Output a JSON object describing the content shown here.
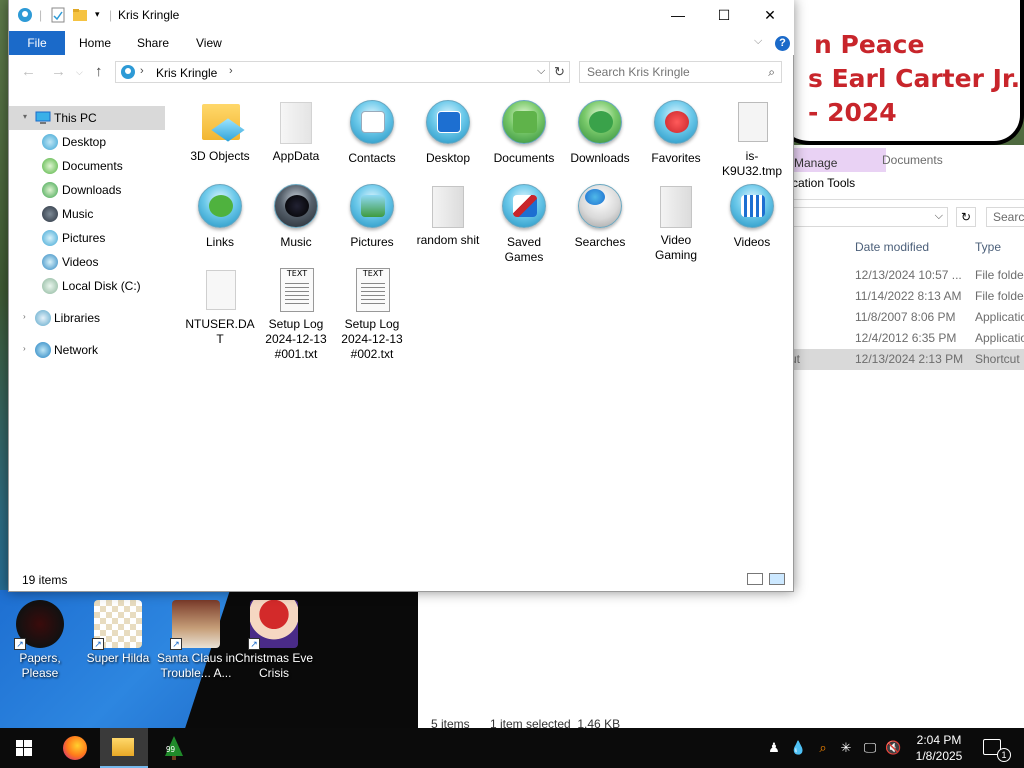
{
  "background_window": {
    "banner_lines": [
      "n Peace",
      "s Earl Carter Jr.",
      "- 2024"
    ],
    "ribbon": {
      "manage_label": "Manage",
      "app_tools_label": "cation Tools",
      "documents_tab": "Documents"
    },
    "search_placeholder": "Searc",
    "columns": {
      "date_modified": "Date modified",
      "type": "Type"
    },
    "rows": [
      {
        "name": "",
        "date": "12/13/2024 10:57 ...",
        "type": "File folde"
      },
      {
        "name": "",
        "date": "11/14/2022 8:13 AM",
        "type": "File folde"
      },
      {
        "name": "",
        "date": "11/8/2007 8:06 PM",
        "type": "Applicatio"
      },
      {
        "name": "",
        "date": "12/4/2012 6:35 PM",
        "type": "Applicatio"
      },
      {
        "name": "ut",
        "date": "12/13/2024 2:13 PM",
        "type": "Shortcut"
      }
    ],
    "status": {
      "items": "5 items",
      "selected": "1 item selected  1.46 KB"
    }
  },
  "desktop_icons": [
    {
      "label": "Papers, Please"
    },
    {
      "label": "Super Hilda"
    },
    {
      "label": "Santa Claus in Trouble... A..."
    },
    {
      "label": "Christmas Eve Crisis"
    }
  ],
  "window": {
    "title": "Kris Kringle",
    "ribbon_tabs": {
      "file": "File",
      "home": "Home",
      "share": "Share",
      "view": "View"
    },
    "help_glyph": "?",
    "address": {
      "crumb": "Kris Kringle"
    },
    "search_placeholder": "Search Kris Kringle",
    "nav_pane": [
      {
        "label": "This PC",
        "icon": "computer-icon"
      },
      {
        "label": "Desktop",
        "icon": "desktop-icon"
      },
      {
        "label": "Documents",
        "icon": "documents-icon"
      },
      {
        "label": "Downloads",
        "icon": "downloads-icon"
      },
      {
        "label": "Music",
        "icon": "music-icon"
      },
      {
        "label": "Pictures",
        "icon": "pictures-icon"
      },
      {
        "label": "Videos",
        "icon": "videos-icon"
      },
      {
        "label": "Local Disk (C:)",
        "icon": "drive-icon"
      },
      {
        "label": "Libraries",
        "icon": "libraries-icon"
      },
      {
        "label": "Network",
        "icon": "network-icon"
      }
    ],
    "items": [
      {
        "label": "3D Objects",
        "icon": "3d-objects-folder-icon"
      },
      {
        "label": "AppData",
        "icon": "hidden-folder-icon"
      },
      {
        "label": "Contacts",
        "icon": "contacts-icon"
      },
      {
        "label": "Desktop",
        "icon": "desktop-folder-icon"
      },
      {
        "label": "Documents",
        "icon": "documents-folder-icon"
      },
      {
        "label": "Downloads",
        "icon": "downloads-folder-icon"
      },
      {
        "label": "Favorites",
        "icon": "favorites-icon"
      },
      {
        "label": "is-K9U32.tmp",
        "icon": "tmp-file-icon"
      },
      {
        "label": "Links",
        "icon": "links-icon"
      },
      {
        "label": "Music",
        "icon": "music-folder-icon"
      },
      {
        "label": "Pictures",
        "icon": "pictures-folder-icon"
      },
      {
        "label": "random shit",
        "icon": "folder-icon"
      },
      {
        "label": "Saved Games",
        "icon": "saved-games-icon"
      },
      {
        "label": "Searches",
        "icon": "searches-icon"
      },
      {
        "label": "Video Gaming",
        "icon": "folder-icon"
      },
      {
        "label": "Videos",
        "icon": "videos-folder-icon"
      },
      {
        "label": "NTUSER.DAT",
        "icon": "dat-file-icon"
      },
      {
        "label": "Setup Log 2024-12-13 #001.txt",
        "icon": "text-file-icon"
      },
      {
        "label": "Setup Log 2024-12-13 #002.txt",
        "icon": "text-file-icon"
      }
    ],
    "text_tag": "TEXT",
    "status": "19 items"
  },
  "taskbar": {
    "clock_time": "2:04 PM",
    "clock_date": "1/8/2025",
    "notification_count": "1",
    "pinned_badge": "99"
  },
  "colors": {
    "accent": "#1b6ac9",
    "selection": "#d9d9d9",
    "taskbar": "#0b0b0b"
  }
}
